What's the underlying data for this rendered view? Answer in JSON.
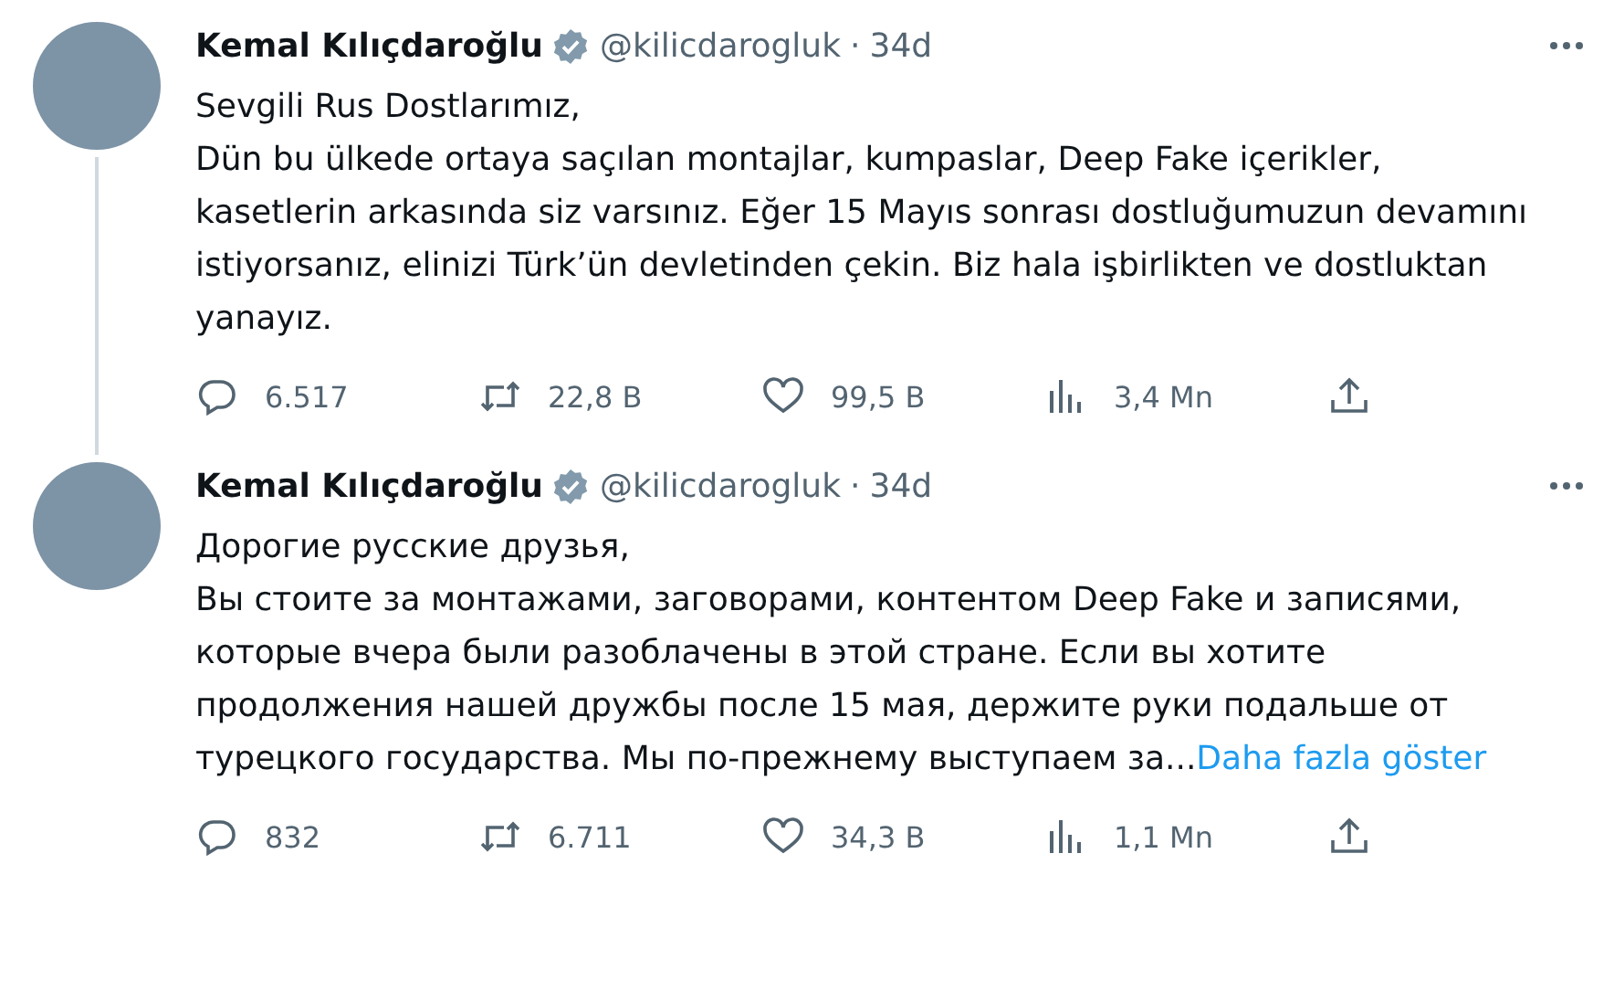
{
  "tweets": [
    {
      "author": "Kemal Kılıçdaroğlu",
      "handle": "@kilicdarogluk",
      "separator": "·",
      "time": "34d",
      "thread_line": true,
      "paragraphs": [
        "Sevgili Rus Dostlarımız,",
        "Dün bu ülkede ortaya saçılan montajlar, kumpaslar, Deep Fake içerikler, kasetlerin arkasında siz varsınız. Eğer 15 Mayıs sonrası dostluğumuzun devamını istiyorsanız, elinizi Türk’ün devletinden çekin. Biz hala işbirlikten ve dostluktan yanayız."
      ],
      "stats": [
        {
          "kind": "reply",
          "count": "6.517"
        },
        {
          "kind": "retweet",
          "count": "22,8 B"
        },
        {
          "kind": "like",
          "count": "99,5 B"
        },
        {
          "kind": "views",
          "count": "3,4 Mn"
        },
        {
          "kind": "share"
        }
      ]
    },
    {
      "author": "Kemal Kılıçdaroğlu",
      "handle": "@kilicdarogluk",
      "separator": "·",
      "time": "34d",
      "paragraphs": [
        "Дорогие русские друзья,",
        "Вы стоите за монтажами, заговорами, контентом Deep Fake и записями, которые вчера были разоблачены в этой стране. Если вы хотите продолжения нашей дружбы после 15 мая, держите руки подальше от турецкого государства. Мы по-прежнему выступаем за..."
      ],
      "show_more": "Daha fazla göster",
      "stats": [
        {
          "kind": "reply",
          "count": "832"
        },
        {
          "kind": "retweet",
          "count": "6.711"
        },
        {
          "kind": "like",
          "count": "34,3 B"
        },
        {
          "kind": "views",
          "count": "1,1 Mn"
        },
        {
          "kind": "share"
        }
      ]
    }
  ]
}
